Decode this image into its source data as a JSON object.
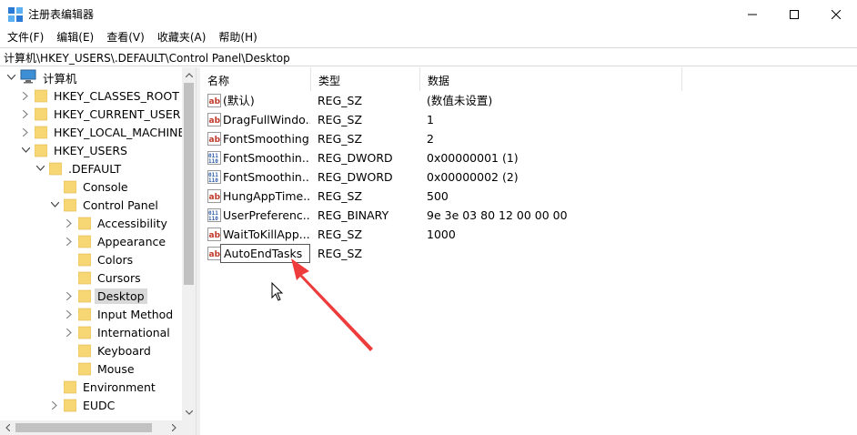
{
  "window": {
    "title": "注册表编辑器",
    "controls": {
      "minimize": "—",
      "maximize": "☐",
      "close": "✕"
    }
  },
  "menu": [
    "文件(F)",
    "编辑(E)",
    "查看(V)",
    "收藏夹(A)",
    "帮助(H)"
  ],
  "address": "计算机\\HKEY_USERS\\.DEFAULT\\Control Panel\\Desktop",
  "tree": [
    {
      "label": "计算机",
      "level": 0,
      "expander": "open",
      "icon": "computer"
    },
    {
      "label": "HKEY_CLASSES_ROOT",
      "level": 1,
      "expander": "closed"
    },
    {
      "label": "HKEY_CURRENT_USER",
      "level": 1,
      "expander": "closed"
    },
    {
      "label": "HKEY_LOCAL_MACHINE",
      "level": 1,
      "expander": "closed"
    },
    {
      "label": "HKEY_USERS",
      "level": 1,
      "expander": "open"
    },
    {
      "label": ".DEFAULT",
      "level": 2,
      "expander": "open"
    },
    {
      "label": "Console",
      "level": 3,
      "expander": "none"
    },
    {
      "label": "Control Panel",
      "level": 3,
      "expander": "open"
    },
    {
      "label": "Accessibility",
      "level": 4,
      "expander": "closed"
    },
    {
      "label": "Appearance",
      "level": 4,
      "expander": "closed"
    },
    {
      "label": "Colors",
      "level": 4,
      "expander": "none"
    },
    {
      "label": "Cursors",
      "level": 4,
      "expander": "none"
    },
    {
      "label": "Desktop",
      "level": 4,
      "expander": "closed",
      "selected": true
    },
    {
      "label": "Input Method",
      "level": 4,
      "expander": "closed"
    },
    {
      "label": "International",
      "level": 4,
      "expander": "closed"
    },
    {
      "label": "Keyboard",
      "level": 4,
      "expander": "none"
    },
    {
      "label": "Mouse",
      "level": 4,
      "expander": "none"
    },
    {
      "label": "Environment",
      "level": 3,
      "expander": "none"
    },
    {
      "label": "EUDC",
      "level": 3,
      "expander": "closed"
    }
  ],
  "columns": {
    "name": "名称",
    "type": "类型",
    "data": "数据"
  },
  "values": [
    {
      "name": "(默认)",
      "type": "REG_SZ",
      "data": "(数值未设置)",
      "icon": "string"
    },
    {
      "name": "DragFullWindo...",
      "type": "REG_SZ",
      "data": "1",
      "icon": "string"
    },
    {
      "name": "FontSmoothing",
      "type": "REG_SZ",
      "data": "2",
      "icon": "string"
    },
    {
      "name": "FontSmoothin...",
      "type": "REG_DWORD",
      "data": "0x00000001 (1)",
      "icon": "binary"
    },
    {
      "name": "FontSmoothin...",
      "type": "REG_DWORD",
      "data": "0x00000002 (2)",
      "icon": "binary"
    },
    {
      "name": "HungAppTime...",
      "type": "REG_SZ",
      "data": "500",
      "icon": "string"
    },
    {
      "name": "UserPreferenc...",
      "type": "REG_BINARY",
      "data": "9e 3e 03 80 12 00 00 00",
      "icon": "binary"
    },
    {
      "name": "WaitToKillApp...",
      "type": "REG_SZ",
      "data": "1000",
      "icon": "string"
    },
    {
      "name": "",
      "type": "REG_SZ",
      "data": "",
      "icon": "string"
    }
  ],
  "rename_value": "AutoEndTasks",
  "colors": {
    "arrow": "#ee3b3b",
    "selection": "#d9d9d9",
    "folder": "#f7d774",
    "string_icon": "#c0392b",
    "binary_icon": "#2f5ea8"
  }
}
